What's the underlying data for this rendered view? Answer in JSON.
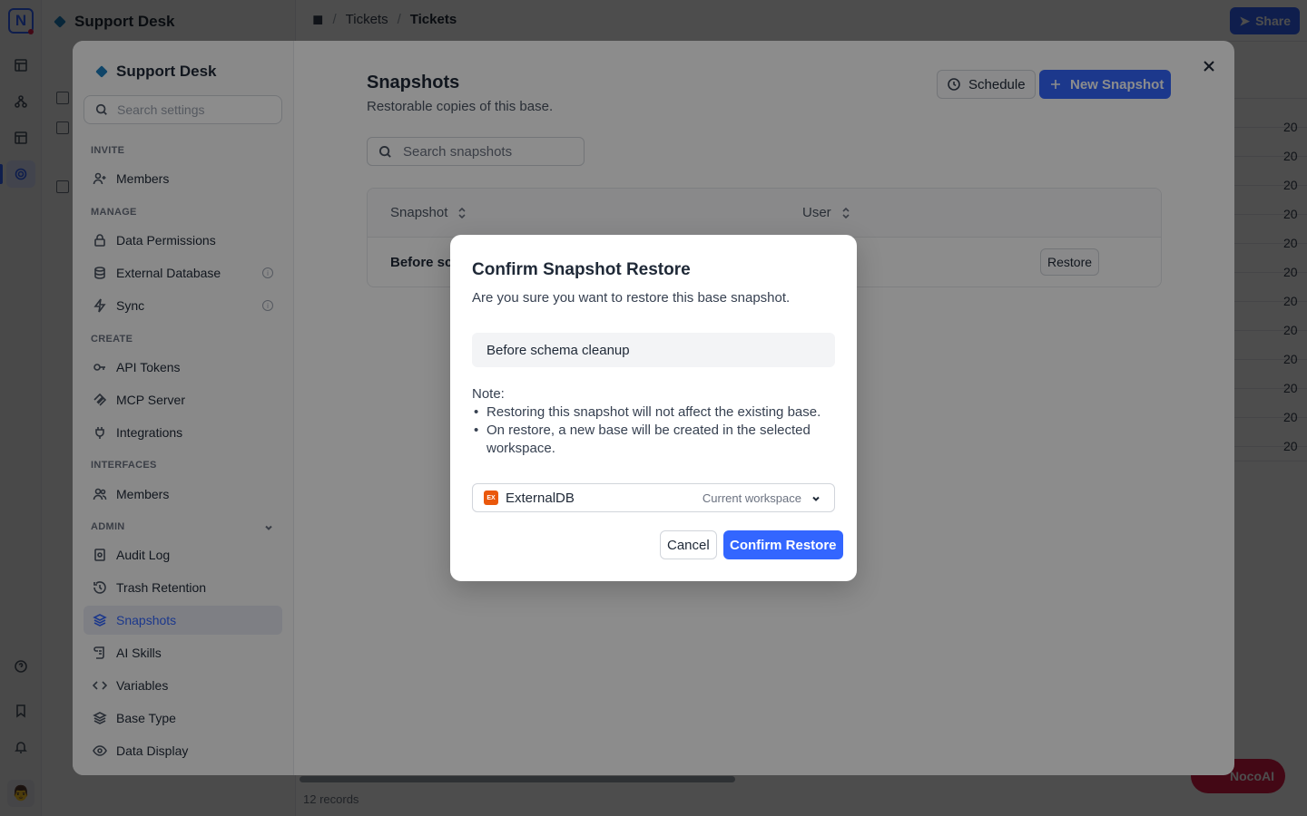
{
  "app": {
    "logo_letter": "N",
    "base_name": "Support Desk",
    "breadcrumbs": [
      "Tickets",
      "Tickets"
    ],
    "share_label": "Share",
    "records_count": "12 records",
    "grid_cell_values": [
      "20",
      "20",
      "20",
      "20",
      "20",
      "20",
      "20",
      "20",
      "20",
      "20",
      "20",
      "20"
    ],
    "nocoai_label": "NocoAI",
    "accent": "#3366ff"
  },
  "settings": {
    "title": "Support Desk",
    "search_placeholder": "Search settings",
    "sections": {
      "invite": "INVITE",
      "manage": "MANAGE",
      "create": "CREATE",
      "interfaces": "INTERFACES",
      "admin": "ADMIN"
    },
    "items": {
      "members_invite": "Members",
      "data_permissions": "Data Permissions",
      "external_database": "External Database",
      "sync": "Sync",
      "api_tokens": "API Tokens",
      "mcp_server": "MCP Server",
      "integrations": "Integrations",
      "members_interfaces": "Members",
      "audit_log": "Audit Log",
      "trash_retention": "Trash Retention",
      "snapshots": "Snapshots",
      "ai_skills": "AI Skills",
      "variables": "Variables",
      "base_type": "Base Type",
      "data_display": "Data Display"
    },
    "info_glyph": "i"
  },
  "snapshots": {
    "title": "Snapshots",
    "subtitle": "Restorable copies of this base.",
    "schedule_label": "Schedule",
    "new_snapshot_label": "New Snapshot",
    "search_placeholder": "Search snapshots",
    "columns": [
      "Snapshot",
      "User"
    ],
    "row": {
      "name": "Before sch",
      "restore_label": "Restore"
    }
  },
  "dialog": {
    "title": "Confirm Snapshot Restore",
    "description": "Are you sure you want to restore this base snapshot.",
    "snapshot_name": "Before schema cleanup",
    "note_label": "Note:",
    "notes": [
      "Restoring this snapshot will not affect the existing base.",
      "On restore, a new base will be created in the selected workspace."
    ],
    "workspace_badge": "EX",
    "workspace_name": "ExternalDB",
    "workspace_hint": "Current workspace",
    "cancel_label": "Cancel",
    "confirm_label": "Confirm Restore"
  }
}
